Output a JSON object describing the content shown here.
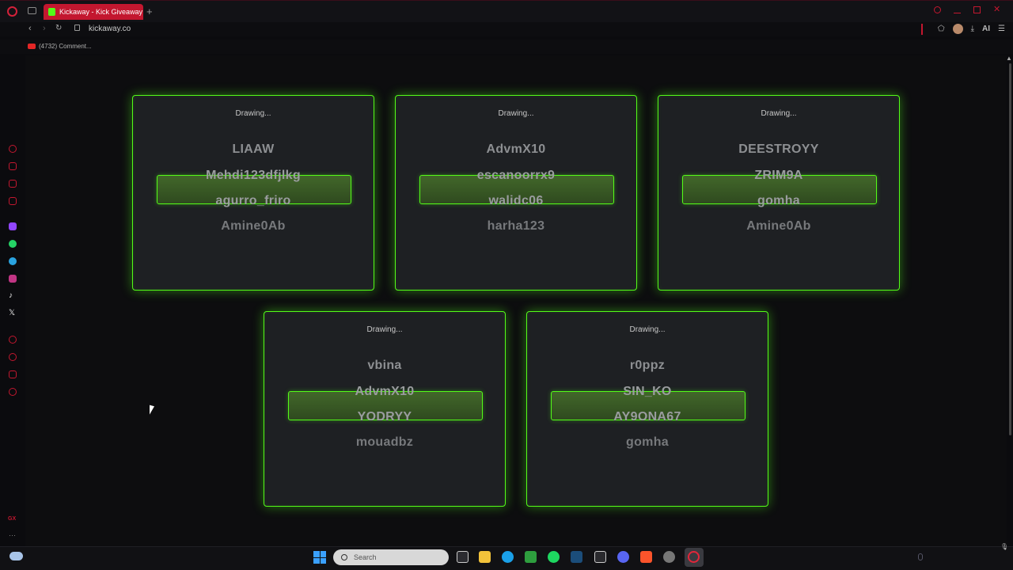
{
  "browser": {
    "tab_title": "Kickaway - Kick Giveaway",
    "new_tab_symbol": "+",
    "url": "kickaway.co",
    "ai_label": "AI",
    "bookmark_label": "(4732) Comment...",
    "sidebar_badge": "GX"
  },
  "cards": [
    {
      "status": "Drawing...",
      "names": [
        "LIAAW",
        "Mehdi123dfjlkg",
        "agurro_friro",
        "Amine0Ab"
      ]
    },
    {
      "status": "Drawing...",
      "names": [
        "AdvmX10",
        "escanoorrx9",
        "walidc06",
        "harha123"
      ]
    },
    {
      "status": "Drawing...",
      "names": [
        "DEESTROYY",
        "ZRIM9A",
        "gomha",
        "Amine0Ab"
      ]
    },
    {
      "status": "Drawing...",
      "names": [
        "vbina",
        "AdvmX10",
        "YODRYY",
        "mouadbz"
      ]
    },
    {
      "status": "Drawing...",
      "names": [
        "r0ppz",
        "SIN_KO",
        "AY9ONA67",
        "gomha"
      ]
    }
  ],
  "taskbar": {
    "search_placeholder": "Search"
  },
  "colors": {
    "accent_green": "#53fc18",
    "opera_red": "#c3172f"
  }
}
